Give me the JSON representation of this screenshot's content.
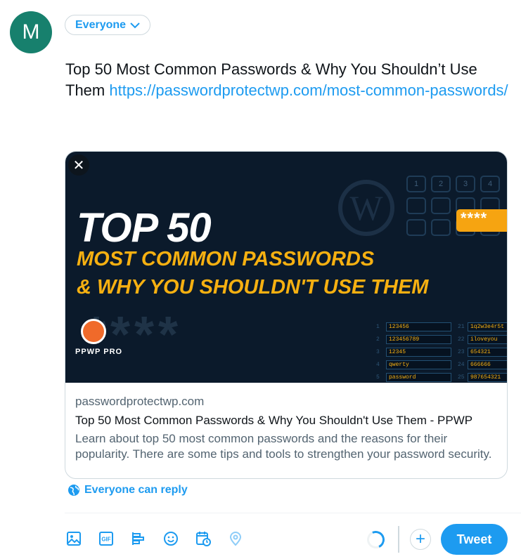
{
  "avatar": {
    "initial": "M",
    "color": "#17806d"
  },
  "audience": {
    "label": "Everyone"
  },
  "tweet_text": {
    "text": "Top 50 Most Common Passwords & Why You Shouldn’t Use Them ",
    "link": "https://passwordprotectwp.com/most-common-passwords/"
  },
  "card": {
    "image": {
      "headline": "TOP 50",
      "line1": "MOST COMMON PASSWORDS",
      "line2": "& WHY YOU SHOULDN'T USE THEM",
      "stars": "****",
      "logo_text": "PPWP PRO",
      "lock_stars": "****",
      "keys": [
        "1",
        "2",
        "3",
        "4",
        "",
        "",
        "",
        "",
        "",
        "",
        "",
        ""
      ],
      "passwords_left": [
        {
          "n": "1",
          "v": "123456"
        },
        {
          "n": "2",
          "v": "123456789"
        },
        {
          "n": "3",
          "v": "12345"
        },
        {
          "n": "4",
          "v": "qwerty"
        },
        {
          "n": "5",
          "v": "password"
        }
      ],
      "passwords_right": [
        {
          "n": "21",
          "v": "1q2w3e4r5t"
        },
        {
          "n": "22",
          "v": "iloveyou"
        },
        {
          "n": "23",
          "v": "654321"
        },
        {
          "n": "24",
          "v": "666666"
        },
        {
          "n": "25",
          "v": "987654321"
        }
      ]
    },
    "domain": "passwordprotectwp.com",
    "title": "Top 50 Most Common Passwords & Why You Shouldn't Use Them - PPWP",
    "description": "Learn about top 50 most common passwords and the reasons for their popularity. There are some tips and tools to strengthen your password security."
  },
  "reply": {
    "label": "Everyone can reply"
  },
  "toolbar": {
    "icons": [
      "image-icon",
      "gif-icon",
      "poll-icon",
      "emoji-icon",
      "schedule-icon",
      "location-icon"
    ],
    "tweet_label": "Tweet",
    "accent": "#1d9bf0"
  }
}
